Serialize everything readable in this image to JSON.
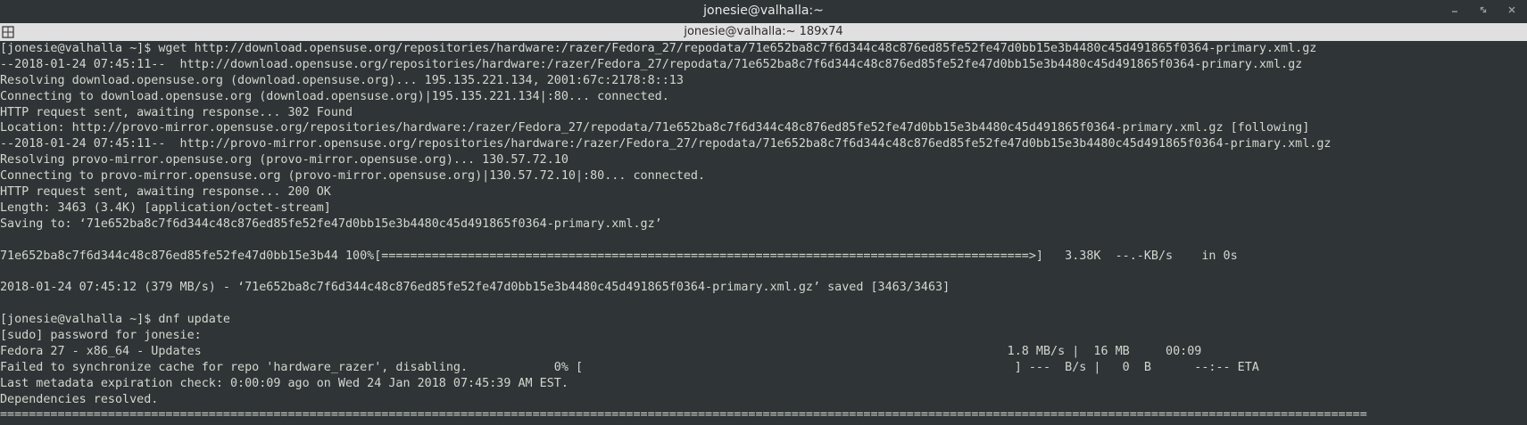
{
  "window": {
    "title": "jonesie@valhalla:~",
    "controls": {
      "minimize": "minimize-icon",
      "maximize": "maximize-icon",
      "close": "close-icon"
    }
  },
  "tab": {
    "title": "jonesie@valhalla:~ 189x74",
    "menu_icon": "terminal-menu-icon"
  },
  "terminal": {
    "lines": [
      "[jonesie@valhalla ~]$ wget http://download.opensuse.org/repositories/hardware:/razer/Fedora_27/repodata/71e652ba8c7f6d344c48c876ed85fe52fe47d0bb15e3b4480c45d491865f0364-primary.xml.gz",
      "--2018-01-24 07:45:11--  http://download.opensuse.org/repositories/hardware:/razer/Fedora_27/repodata/71e652ba8c7f6d344c48c876ed85fe52fe47d0bb15e3b4480c45d491865f0364-primary.xml.gz",
      "Resolving download.opensuse.org (download.opensuse.org)... 195.135.221.134, 2001:67c:2178:8::13",
      "Connecting to download.opensuse.org (download.opensuse.org)|195.135.221.134|:80... connected.",
      "HTTP request sent, awaiting response... 302 Found",
      "Location: http://provo-mirror.opensuse.org/repositories/hardware:/razer/Fedora_27/repodata/71e652ba8c7f6d344c48c876ed85fe52fe47d0bb15e3b4480c45d491865f0364-primary.xml.gz [following]",
      "--2018-01-24 07:45:11--  http://provo-mirror.opensuse.org/repositories/hardware:/razer/Fedora_27/repodata/71e652ba8c7f6d344c48c876ed85fe52fe47d0bb15e3b4480c45d491865f0364-primary.xml.gz",
      "Resolving provo-mirror.opensuse.org (provo-mirror.opensuse.org)... 130.57.72.10",
      "Connecting to provo-mirror.opensuse.org (provo-mirror.opensuse.org)|130.57.72.10|:80... connected.",
      "HTTP request sent, awaiting response... 200 OK",
      "Length: 3463 (3.4K) [application/octet-stream]",
      "Saving to: ‘71e652ba8c7f6d344c48c876ed85fe52fe47d0bb15e3b4480c45d491865f0364-primary.xml.gz’",
      "",
      "71e652ba8c7f6d344c48c876ed85fe52fe47d0bb15e3b44 100%[==========================================================================================>]   3.38K  --.-KB/s    in 0s",
      "",
      "2018-01-24 07:45:12 (379 MB/s) - ‘71e652ba8c7f6d344c48c876ed85fe52fe47d0bb15e3b4480c45d491865f0364-primary.xml.gz’ saved [3463/3463]",
      "",
      "[jonesie@valhalla ~]$ dnf update",
      "[sudo] password for jonesie:",
      "Fedora 27 - x86_64 - Updates                                                                                                                1.8 MB/s |  16 MB     00:09",
      "Failed to synchronize cache for repo 'hardware_razer', disabling.            0% [                                                            ] ---  B/s |   0  B      --:-- ETA",
      "Last metadata expiration check: 0:00:09 ago on Wed 24 Jan 2018 07:45:39 AM EST.",
      "Dependencies resolved.",
      "=============================================================================================================================================================================================="
    ]
  }
}
